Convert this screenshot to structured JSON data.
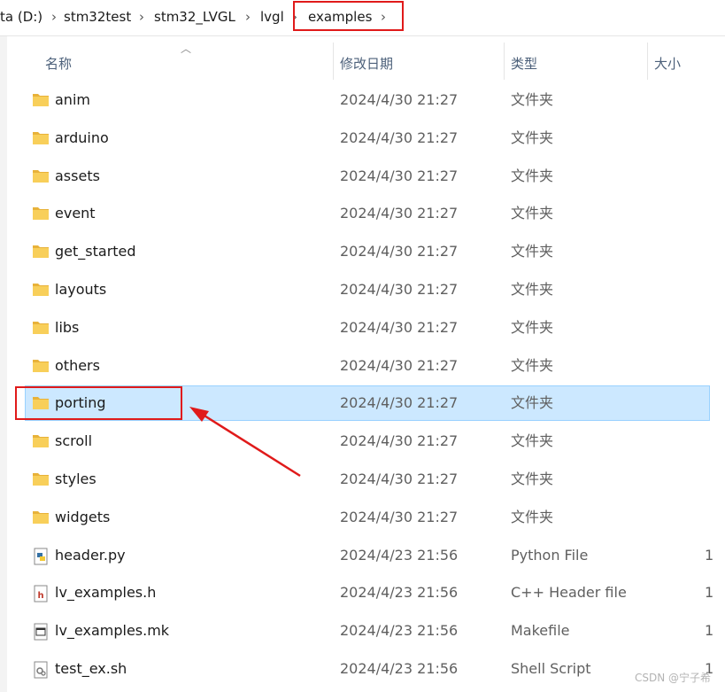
{
  "breadcrumb": {
    "items": [
      "ta (D:)",
      "stm32test",
      "stm32_LVGL",
      "lvgl",
      "examples"
    ],
    "separator": "›",
    "highlighted_item": "examples"
  },
  "columns": {
    "name": "名称",
    "date": "修改日期",
    "type": "类型",
    "size": "大小"
  },
  "files": [
    {
      "name": "anim",
      "date": "2024/4/30 21:27",
      "type": "文件夹",
      "size": "",
      "icon": "folder-icon"
    },
    {
      "name": "arduino",
      "date": "2024/4/30 21:27",
      "type": "文件夹",
      "size": "",
      "icon": "folder-icon"
    },
    {
      "name": "assets",
      "date": "2024/4/30 21:27",
      "type": "文件夹",
      "size": "",
      "icon": "folder-icon"
    },
    {
      "name": "event",
      "date": "2024/4/30 21:27",
      "type": "文件夹",
      "size": "",
      "icon": "folder-icon"
    },
    {
      "name": "get_started",
      "date": "2024/4/30 21:27",
      "type": "文件夹",
      "size": "",
      "icon": "folder-icon"
    },
    {
      "name": "layouts",
      "date": "2024/4/30 21:27",
      "type": "文件夹",
      "size": "",
      "icon": "folder-icon"
    },
    {
      "name": "libs",
      "date": "2024/4/30 21:27",
      "type": "文件夹",
      "size": "",
      "icon": "folder-icon"
    },
    {
      "name": "others",
      "date": "2024/4/30 21:27",
      "type": "文件夹",
      "size": "",
      "icon": "folder-icon"
    },
    {
      "name": "porting",
      "date": "2024/4/30 21:27",
      "type": "文件夹",
      "size": "",
      "icon": "folder-icon",
      "selected": true
    },
    {
      "name": "scroll",
      "date": "2024/4/30 21:27",
      "type": "文件夹",
      "size": "",
      "icon": "folder-icon"
    },
    {
      "name": "styles",
      "date": "2024/4/30 21:27",
      "type": "文件夹",
      "size": "",
      "icon": "folder-icon"
    },
    {
      "name": "widgets",
      "date": "2024/4/30 21:27",
      "type": "文件夹",
      "size": "",
      "icon": "folder-icon"
    },
    {
      "name": "header.py",
      "date": "2024/4/23 21:56",
      "type": "Python File",
      "size": "1",
      "icon": "python-file-icon"
    },
    {
      "name": "lv_examples.h",
      "date": "2024/4/23 21:56",
      "type": "C++ Header file",
      "size": "1",
      "icon": "c-header-file-icon"
    },
    {
      "name": "lv_examples.mk",
      "date": "2024/4/23 21:56",
      "type": "Makefile",
      "size": "1",
      "icon": "makefile-icon"
    },
    {
      "name": "test_ex.sh",
      "date": "2024/4/23 21:56",
      "type": "Shell Script",
      "size": "1",
      "icon": "shell-script-icon"
    }
  ],
  "watermark": "CSDN @宁子希",
  "colors": {
    "selection": "#cce8ff",
    "annotation_red": "#e01a1a",
    "folder_yellow": "#f5c242"
  }
}
